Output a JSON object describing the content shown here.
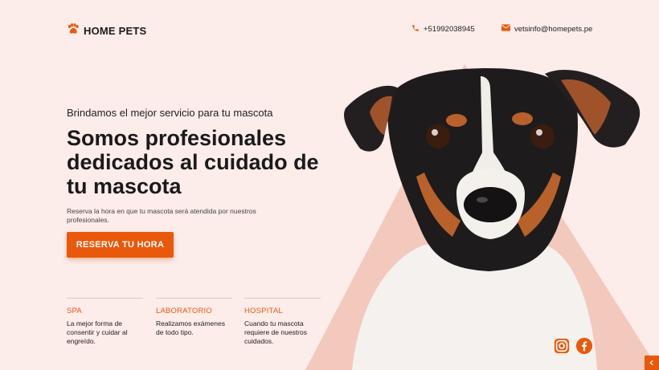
{
  "brand": {
    "name": "HOME PETS",
    "accent": "#e8590c",
    "background": "#fcecea",
    "shape": "#f3c9bd"
  },
  "contact": {
    "phone": "+51992038945",
    "email": "vetsinfo@homepets.pe"
  },
  "hero": {
    "eyebrow": "Brindamos el mejor servicio para tu mascota",
    "headline": "Somos profesionales dedicados al cuidado de tu mascota",
    "lead": "Reserva la hora en que tu mascota será atendida por nuestros profesionales.",
    "cta_label": "RESERVA TU HORA"
  },
  "services": [
    {
      "title": "SPA",
      "desc": "La mejor forma de consentir y cuidar al engreído."
    },
    {
      "title": "LABORATORIO",
      "desc": "Realizamos exámenes de todo tipo."
    },
    {
      "title": "HOSPITAL",
      "desc": "Cuando tu mascota requiere de nuestros cuidados."
    }
  ],
  "icons": {
    "logo": "paw-icon",
    "phone": "phone-icon",
    "email": "mail-icon",
    "instagram": "instagram-icon",
    "facebook": "facebook-icon",
    "scroll": "chevron-left-icon"
  }
}
